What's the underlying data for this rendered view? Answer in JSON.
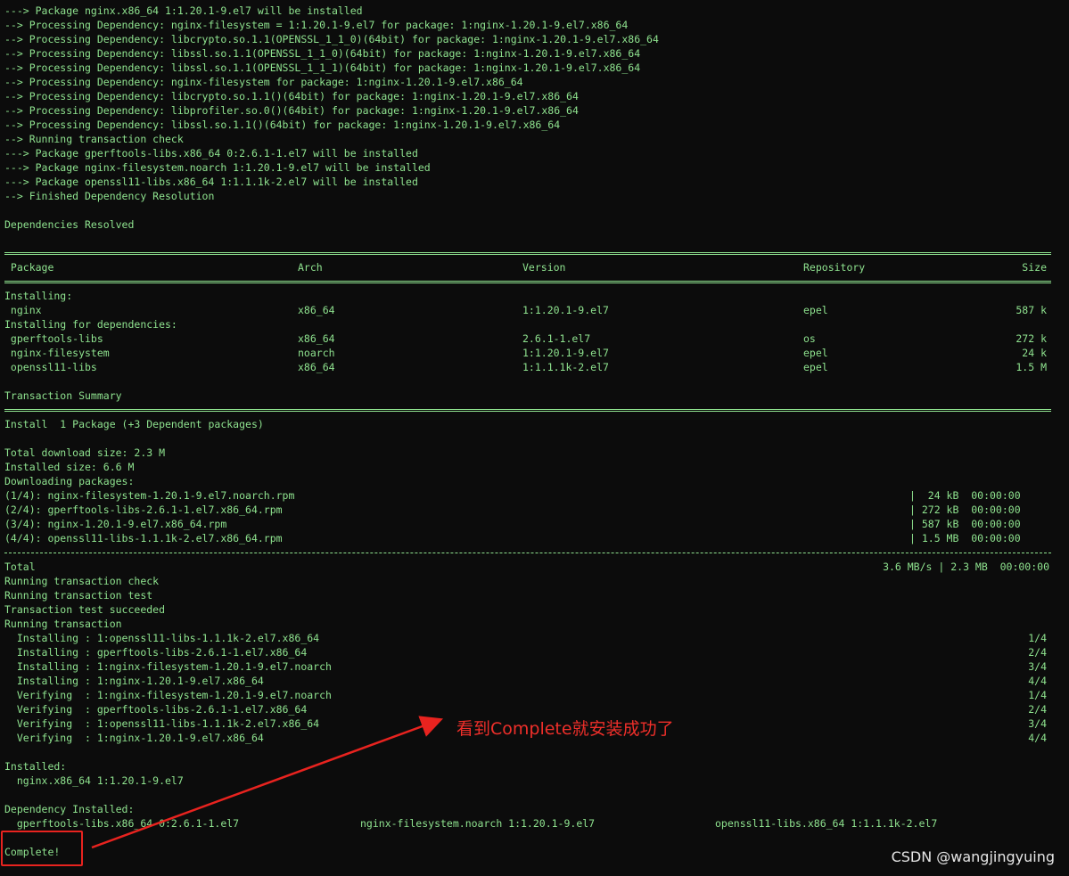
{
  "colors": {
    "background": "#0c0c0c",
    "text": "#8fe38f",
    "annotation": "#e8231f"
  },
  "log": {
    "pre": [
      "---> Package nginx.x86_64 1:1.20.1-9.el7 will be installed",
      "--> Processing Dependency: nginx-filesystem = 1:1.20.1-9.el7 for package: 1:nginx-1.20.1-9.el7.x86_64",
      "--> Processing Dependency: libcrypto.so.1.1(OPENSSL_1_1_0)(64bit) for package: 1:nginx-1.20.1-9.el7.x86_64",
      "--> Processing Dependency: libssl.so.1.1(OPENSSL_1_1_0)(64bit) for package: 1:nginx-1.20.1-9.el7.x86_64",
      "--> Processing Dependency: libssl.so.1.1(OPENSSL_1_1_1)(64bit) for package: 1:nginx-1.20.1-9.el7.x86_64",
      "--> Processing Dependency: nginx-filesystem for package: 1:nginx-1.20.1-9.el7.x86_64",
      "--> Processing Dependency: libcrypto.so.1.1()(64bit) for package: 1:nginx-1.20.1-9.el7.x86_64",
      "--> Processing Dependency: libprofiler.so.0()(64bit) for package: 1:nginx-1.20.1-9.el7.x86_64",
      "--> Processing Dependency: libssl.so.1.1()(64bit) for package: 1:nginx-1.20.1-9.el7.x86_64",
      "--> Running transaction check",
      "---> Package gperftools-libs.x86_64 0:2.6.1-1.el7 will be installed",
      "---> Package nginx-filesystem.noarch 1:1.20.1-9.el7 will be installed",
      "---> Package openssl11-libs.x86_64 1:1.1.1k-2.el7 will be installed",
      "--> Finished Dependency Resolution"
    ],
    "resolved": "Dependencies Resolved",
    "table": {
      "headers": [
        " Package",
        "Arch",
        "Version",
        "Repository",
        "Size"
      ],
      "installing_label": "Installing:",
      "deps_label": "Installing for dependencies:",
      "installing": [
        [
          " nginx",
          "x86_64",
          "1:1.20.1-9.el7",
          "epel",
          "587 k"
        ]
      ],
      "deps": [
        [
          " gperftools-libs",
          "x86_64",
          "2.6.1-1.el7",
          "os",
          "272 k"
        ],
        [
          " nginx-filesystem",
          "noarch",
          "1:1.20.1-9.el7",
          "epel",
          "24 k"
        ],
        [
          " openssl11-libs",
          "x86_64",
          "1:1.1.1k-2.el7",
          "epel",
          "1.5 M"
        ]
      ]
    },
    "summary_title": "Transaction Summary",
    "summary_line": "Install  1 Package (+3 Dependent packages)",
    "download_size": "Total download size: 2.3 M",
    "installed_size": "Installed size: 6.6 M",
    "downloading": "Downloading packages:",
    "downloads": [
      [
        "(1/4): nginx-filesystem-1.20.1-9.el7.noarch.rpm",
        "|  24 kB  00:00:00"
      ],
      [
        "(2/4): gperftools-libs-2.6.1-1.el7.x86_64.rpm",
        "| 272 kB  00:00:00"
      ],
      [
        "(3/4): nginx-1.20.1-9.el7.x86_64.rpm",
        "| 587 kB  00:00:00"
      ],
      [
        "(4/4): openssl11-libs-1.1.1k-2.el7.x86_64.rpm",
        "| 1.5 MB  00:00:00"
      ]
    ],
    "total_label": "Total",
    "total_rate": "3.6 MB/s | 2.3 MB  00:00:00",
    "run": [
      "Running transaction check",
      "Running transaction test",
      "Transaction test succeeded",
      "Running transaction"
    ],
    "steps": [
      [
        "  Installing : 1:openssl11-libs-1.1.1k-2.el7.x86_64",
        "1/4"
      ],
      [
        "  Installing : gperftools-libs-2.6.1-1.el7.x86_64",
        "2/4"
      ],
      [
        "  Installing : 1:nginx-filesystem-1.20.1-9.el7.noarch",
        "3/4"
      ],
      [
        "  Installing : 1:nginx-1.20.1-9.el7.x86_64",
        "4/4"
      ],
      [
        "  Verifying  : 1:nginx-filesystem-1.20.1-9.el7.noarch",
        "1/4"
      ],
      [
        "  Verifying  : gperftools-libs-2.6.1-1.el7.x86_64",
        "2/4"
      ],
      [
        "  Verifying  : 1:openssl11-libs-1.1.1k-2.el7.x86_64",
        "3/4"
      ],
      [
        "  Verifying  : 1:nginx-1.20.1-9.el7.x86_64",
        "4/4"
      ]
    ],
    "installed_label": "Installed:",
    "installed_pkg": "  nginx.x86_64 1:1.20.1-9.el7",
    "dep_installed_label": "Dependency Installed:",
    "dep_installed": [
      "  gperftools-libs.x86_64 0:2.6.1-1.el7",
      "nginx-filesystem.noarch 1:1.20.1-9.el7",
      "openssl11-libs.x86_64 1:1.1.1k-2.el7"
    ],
    "complete": "Complete!"
  },
  "annotation": {
    "text": "看到Complete就安装成功了"
  },
  "watermark": "CSDN @wangjingyuing"
}
